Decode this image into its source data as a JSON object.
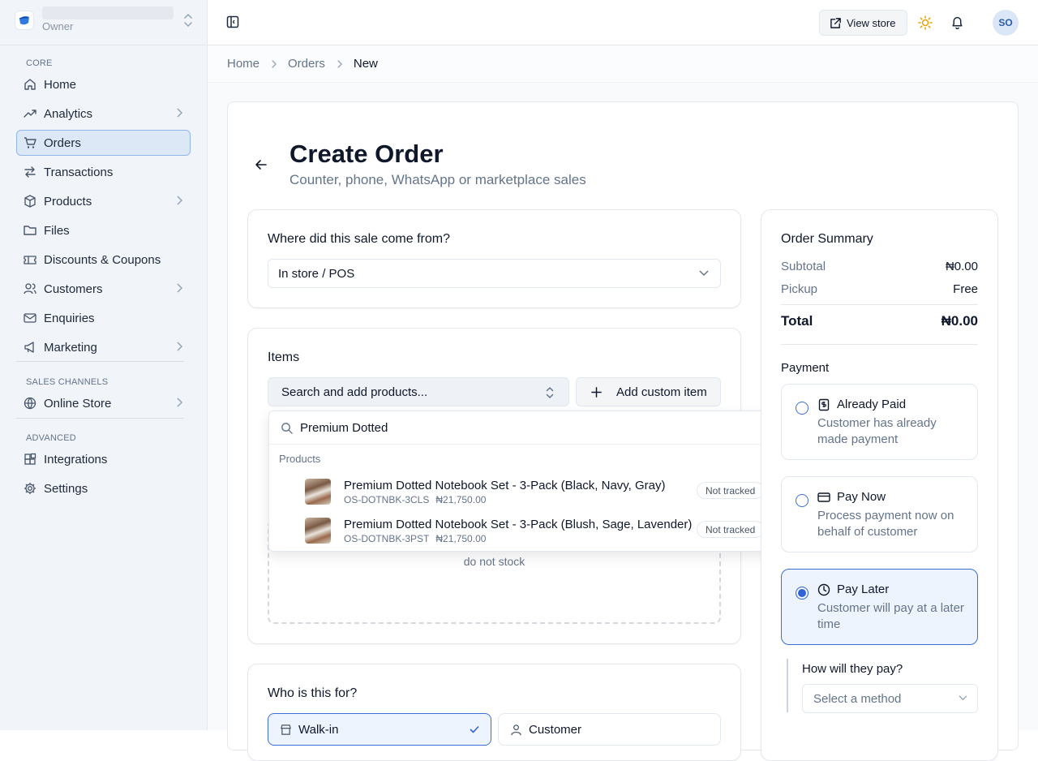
{
  "sidebar": {
    "store_role": "Owner",
    "sections": {
      "core": "CORE",
      "sales_channels": "SALES CHANNELS",
      "advanced": "ADVANCED"
    },
    "items": [
      {
        "label": "Home",
        "icon": "home-icon"
      },
      {
        "label": "Analytics",
        "icon": "trending-up-icon"
      },
      {
        "label": "Orders",
        "icon": "cart-icon",
        "active": true
      },
      {
        "label": "Transactions",
        "icon": "arrows-swap-icon"
      },
      {
        "label": "Products",
        "icon": "box-icon"
      },
      {
        "label": "Files",
        "icon": "folder-icon"
      },
      {
        "label": "Discounts & Coupons",
        "icon": "ticket-icon"
      },
      {
        "label": "Customers",
        "icon": "users-icon"
      },
      {
        "label": "Enquiries",
        "icon": "mail-icon"
      },
      {
        "label": "Marketing",
        "icon": "megaphone-icon"
      },
      {
        "label": "Online Store",
        "icon": "globe-icon"
      },
      {
        "label": "Integrations",
        "icon": "blocks-icon"
      },
      {
        "label": "Settings",
        "icon": "gear-icon"
      }
    ]
  },
  "topbar": {
    "view_store": "View store",
    "avatar_initials": "SO"
  },
  "breadcrumb": [
    "Home",
    "Orders",
    "New"
  ],
  "page": {
    "title": "Create Order",
    "subtitle": "Counter, phone, WhatsApp or marketplace sales"
  },
  "source": {
    "title": "Where did this sale come from?",
    "value": "In store / POS"
  },
  "items": {
    "title": "Items",
    "search_placeholder": "Search and add products...",
    "custom_item": "Add custom item",
    "empty_text": "do not stock"
  },
  "dropdown": {
    "query": "Premium Dotted",
    "group": "Products",
    "results": [
      {
        "name": "Premium Dotted Notebook Set - 3-Pack (Black, Navy, Gray)",
        "sku": "OS-DOTNBK-3CLS",
        "price": "₦21,750.00",
        "stock": "Not tracked"
      },
      {
        "name": "Premium Dotted Notebook Set - 3-Pack (Blush, Sage, Lavender)",
        "sku": "OS-DOTNBK-3PST",
        "price": "₦21,750.00",
        "stock": "Not tracked"
      }
    ]
  },
  "customer": {
    "title": "Who is this for?",
    "walk_in": "Walk-in",
    "customer": "Customer"
  },
  "summary": {
    "title": "Order Summary",
    "subtotal_label": "Subtotal",
    "subtotal": "₦0.00",
    "pickup_label": "Pickup",
    "pickup": "Free",
    "total_label": "Total",
    "total": "₦0.00",
    "payment_label": "Payment",
    "options": [
      {
        "title": "Already Paid",
        "desc": "Customer has already made payment",
        "icon": "receipt-icon",
        "selected": false
      },
      {
        "title": "Pay Now",
        "desc": "Process payment now on behalf of customer",
        "icon": "card-icon",
        "selected": false
      },
      {
        "title": "Pay Later",
        "desc": "Customer will pay at a later time",
        "icon": "clock-icon",
        "selected": true
      }
    ],
    "how_label": "How will they pay?",
    "method_placeholder": "Select a method"
  },
  "colors": {
    "accent": "#2f63d6",
    "active_nav_bg": "#dde8f7",
    "sun": "#e6a100"
  }
}
